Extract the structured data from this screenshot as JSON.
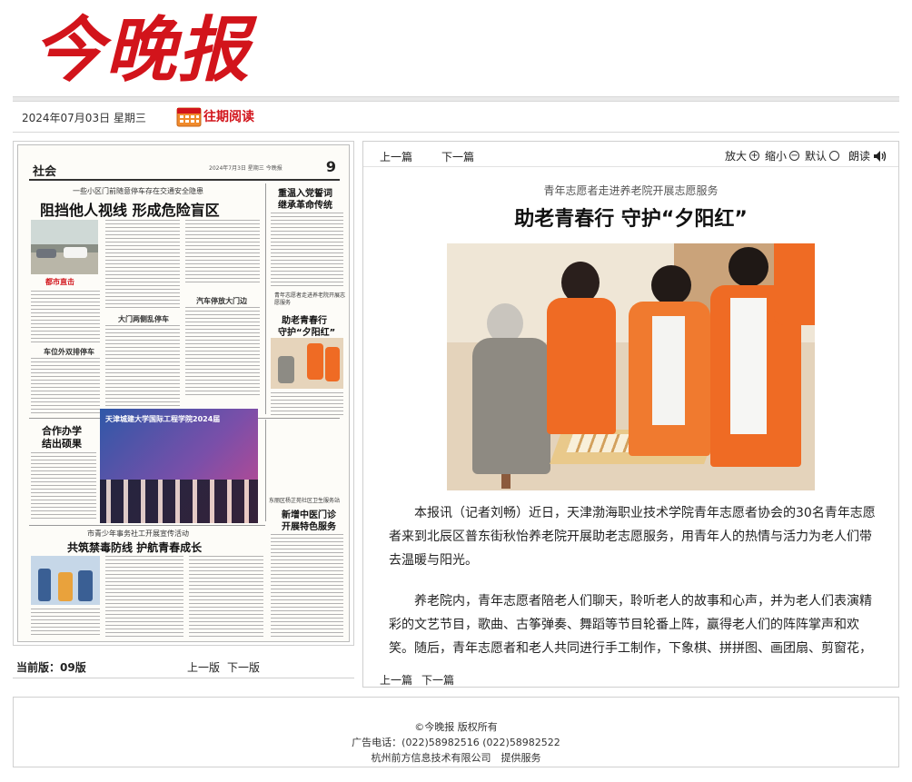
{
  "brand": {
    "logo_text": "今晚报",
    "accent": "#d2141b"
  },
  "datebar": {
    "date": "2024年07月03日 星期三",
    "archive_label": "往期阅读"
  },
  "paper": {
    "section": "社会",
    "page_number": "9",
    "meta": "2024年7月3日 星期三  今晚报",
    "kicker_top": "一些小区门前随意停车存在交通安全隐患",
    "headline_top": "阻挡他人视线  形成危险盲区",
    "caption_photo": "都市直击",
    "side_title_1": "重温入党誓词",
    "side_title_2": "继承革命传统",
    "sub_head_1": "车位外双排停车",
    "sub_head_2": "大门两侧乱停车",
    "sub_head_3": "汽车停放大门边",
    "kicker_volunteer": "青年志愿者走进养老院开展志愿服务",
    "headline_volunteer_1": "助老青春行",
    "headline_volunteer_2": "守护“夕阳红”",
    "side_title_3": "合作办学",
    "side_title_4": "结出硕果",
    "banner_text": "天津城建大学国际工程学院2024届",
    "kicker_clinic": "东丽区杨芷苑社区卫生服务站",
    "headline_clinic_1": "新增中医门诊",
    "headline_clinic_2": "开展特色服务",
    "kicker_bottom": "市青少年事务社工开展宣传活动",
    "headline_bottom": "共筑禁毒防线  护航青春成长"
  },
  "edition": {
    "label": "当前版：",
    "value": "09版",
    "prev": "上一版",
    "next": "下一版"
  },
  "toolbar": {
    "prev": "上一篇",
    "next": "下一篇",
    "zoom_in": "放大",
    "zoom_out": "缩小",
    "default": "默认",
    "read": "朗读"
  },
  "article": {
    "subtitle": "青年志愿者走进养老院开展志愿服务",
    "title": "助老青春行  守护“夕阳红”",
    "paragraphs": [
      "本报讯（记者刘畅）近日，天津渤海职业技术学院青年志愿者协会的30名青年志愿者来到北辰区普东街秋怡养老院开展助老志愿服务，用青年人的热情与活力为老人们带去温暖与阳光。",
      "养老院内，青年志愿者陪老人们聊天，聆听老人的故事和心声，并为老人们表演精彩的文艺节目，歌曲、古筝弹奏、舞蹈等节目轮番上阵，赢得老人们的阵阵掌声和欢笑。随后，青年志愿者和老人共同进行手工制作，下象棋、拼拼图、画团扇、剪窗花，老人们的"
    ]
  },
  "bottom_nav": {
    "prev": "上一篇",
    "next": "下一篇"
  },
  "copyright": {
    "owner": "©今晚报 版权所有",
    "ad_phone": "广告电话：(022)58982516 (022)58982522",
    "provider": "杭州前方信息技术有限公司　提供服务"
  }
}
